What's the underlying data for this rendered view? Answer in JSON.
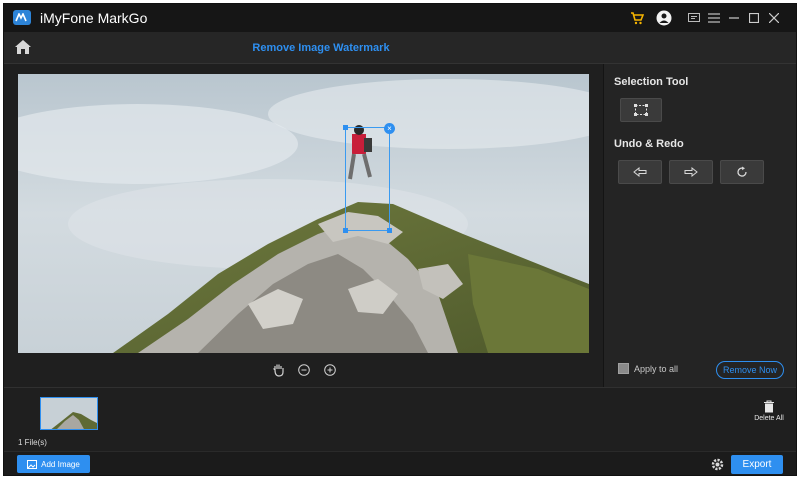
{
  "app": {
    "title": "iMyFone MarkGo"
  },
  "titlebar": {
    "icons": [
      "cart-icon",
      "account-icon",
      "feedback-icon",
      "menu-icon",
      "minimize-icon",
      "maximize-icon",
      "close-icon"
    ],
    "cart_color": "#f5b400"
  },
  "header": {
    "title": "Remove Image Watermark",
    "home_icon": "home-icon"
  },
  "canvas": {
    "zoom_tools": [
      "hand-icon",
      "zoom-out-icon",
      "zoom-in-icon"
    ],
    "selection_close": "×"
  },
  "right_panel": {
    "selection_tool_title": "Selection Tool",
    "undo_redo_title": "Undo & Redo",
    "apply_to_all_label": "Apply to all",
    "apply_to_all_checked": false,
    "remove_now_label": "Remove Now"
  },
  "files": {
    "count_label": "1 File(s)",
    "delete_all_label": "Delete All"
  },
  "footer": {
    "add_image_label": "Add Image",
    "export_label": "Export"
  },
  "colors": {
    "accent": "#2e8ff0",
    "background": "#1f1f1f",
    "panel": "#242424"
  }
}
